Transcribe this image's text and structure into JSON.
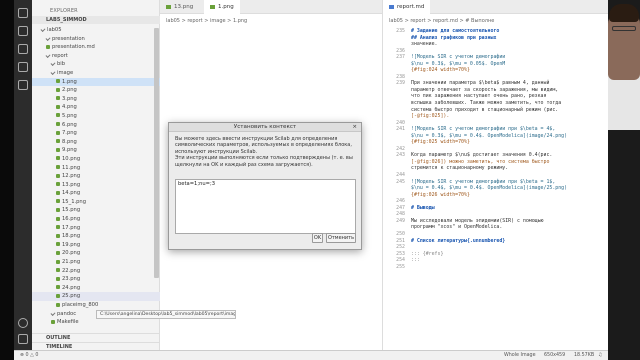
{
  "explorer": {
    "title": "EXPLORER",
    "project": "LAB5_SIMMOD",
    "items": [
      {
        "label": "lab05",
        "kind": "folder",
        "indent": 1
      },
      {
        "label": "presentation",
        "kind": "folder",
        "indent": 2
      },
      {
        "label": "presentation.md",
        "kind": "file",
        "indent": 2
      },
      {
        "label": "report",
        "kind": "folder",
        "indent": 2
      },
      {
        "label": "bib",
        "kind": "folder",
        "indent": 3
      },
      {
        "label": "image",
        "kind": "folder",
        "indent": 3
      },
      {
        "label": "1.png",
        "kind": "file",
        "indent": 4,
        "selected": true
      },
      {
        "label": "2.png",
        "kind": "file",
        "indent": 4
      },
      {
        "label": "3.png",
        "kind": "file",
        "indent": 4
      },
      {
        "label": "4.png",
        "kind": "file",
        "indent": 4
      },
      {
        "label": "5.png",
        "kind": "file",
        "indent": 4
      },
      {
        "label": "6.png",
        "kind": "file",
        "indent": 4
      },
      {
        "label": "7.png",
        "kind": "file",
        "indent": 4
      },
      {
        "label": "8.png",
        "kind": "file",
        "indent": 4
      },
      {
        "label": "9.png",
        "kind": "file",
        "indent": 4
      },
      {
        "label": "10.png",
        "kind": "file",
        "indent": 4
      },
      {
        "label": "11.png",
        "kind": "file",
        "indent": 4
      },
      {
        "label": "12.png",
        "kind": "file",
        "indent": 4
      },
      {
        "label": "13.png",
        "kind": "file",
        "indent": 4
      },
      {
        "label": "14.png",
        "kind": "file",
        "indent": 4
      },
      {
        "label": "15_1.png",
        "kind": "file",
        "indent": 4
      },
      {
        "label": "15.png",
        "kind": "file",
        "indent": 4
      },
      {
        "label": "16.png",
        "kind": "file",
        "indent": 4
      },
      {
        "label": "17.png",
        "kind": "file",
        "indent": 4
      },
      {
        "label": "18.png",
        "kind": "file",
        "indent": 4
      },
      {
        "label": "19.png",
        "kind": "file",
        "indent": 4
      },
      {
        "label": "20.png",
        "kind": "file",
        "indent": 4
      },
      {
        "label": "21.png",
        "kind": "file",
        "indent": 4
      },
      {
        "label": "22.png",
        "kind": "file",
        "indent": 4
      },
      {
        "label": "23.png",
        "kind": "file",
        "indent": 4
      },
      {
        "label": "24.png",
        "kind": "file",
        "indent": 4
      },
      {
        "label": "25.png",
        "kind": "file",
        "indent": 4,
        "hover": true
      },
      {
        "label": "placeimg_800",
        "kind": "file",
        "indent": 4
      },
      {
        "label": "pandoc",
        "kind": "folder",
        "indent": 3
      },
      {
        "label": "Makefile",
        "kind": "file",
        "indent": 3
      }
    ],
    "tooltip": "C:\\Users\\angelina\\Desktop\\lab5_simmod\\lab05\\report\\image\\25.png",
    "outline": "OUTLINE",
    "timeline": "TIMELINE"
  },
  "image_pane": {
    "tabs": [
      "13.png",
      "1.png"
    ],
    "breadcrumb": "lab05 > report > image > 1.png"
  },
  "md_pane": {
    "tab": "report.md",
    "breadcrumb": "lab05 > report > report.md > # Выполне",
    "lines": [
      {
        "n": "235",
        "t": "# Задание для самостоятельного",
        "c": "h"
      },
      {
        "n": "",
        "t": "## Анализ графиков при разных",
        "c": "h"
      },
      {
        "n": "",
        "t": "значение.",
        "c": ""
      },
      {
        "n": "236",
        "t": "",
        "c": ""
      },
      {
        "n": "237",
        "t": "![Модель SIR с учетом демографии",
        "c": "link"
      },
      {
        "n": "",
        "t": "$\\nu = 0.3$, $\\mu = 0.05$. OpenM",
        "c": "link"
      },
      {
        "n": "",
        "t": "{#fig:024 width=70%}",
        "c": "ref"
      },
      {
        "n": "238",
        "t": "",
        "c": ""
      },
      {
        "n": "239",
        "t": "При значении параметра $\\beta$ равным 4, данный",
        "c": ""
      },
      {
        "n": "",
        "t": "параметр отвечает за скорость заражения, мы видим,",
        "c": ""
      },
      {
        "n": "",
        "t": "что пик заражения наступает очень рано, резкая",
        "c": ""
      },
      {
        "n": "",
        "t": "вспышка заболевших. Также можно заметить, что тогда",
        "c": ""
      },
      {
        "n": "",
        "t": "система быстро приходит в стационарный режим (рис.",
        "c": ""
      },
      {
        "n": "",
        "t": "[-@fig:025]).",
        "c": "ref"
      },
      {
        "n": "240",
        "t": "",
        "c": ""
      },
      {
        "n": "241",
        "t": "![Модель SIR с учетом демографии при $\\beta = 4$,",
        "c": "link"
      },
      {
        "n": "",
        "t": "$\\nu = 0.3$, $\\mu = 0.4$. OpenModelica](image/24.png)",
        "c": "link"
      },
      {
        "n": "",
        "t": "{#fig:025 width=70%}",
        "c": "ref"
      },
      {
        "n": "242",
        "t": "",
        "c": ""
      },
      {
        "n": "243",
        "t": "Когда параметр $\\nu$ достигает значения 0.4(рис.",
        "c": ""
      },
      {
        "n": "",
        "t": "[-@fig:026]) можно заметить, что система быстро",
        "c": "ref"
      },
      {
        "n": "",
        "t": "стремится к стационарному режиму.",
        "c": ""
      },
      {
        "n": "244",
        "t": "",
        "c": ""
      },
      {
        "n": "245",
        "t": "![Модель SIR с учетом демографии при $\\beta = 1$,",
        "c": "link"
      },
      {
        "n": "",
        "t": "$\\nu = 0.4$, $\\mu = 0.4$. OpenModelica](image/25.png)",
        "c": "link"
      },
      {
        "n": "",
        "t": "{#fig:026 width=70%}",
        "c": "ref"
      },
      {
        "n": "246",
        "t": "",
        "c": ""
      },
      {
        "n": "247",
        "t": "# Выводы",
        "c": "h"
      },
      {
        "n": "248",
        "t": "",
        "c": ""
      },
      {
        "n": "249",
        "t": "Мы исследовали модель эпидемии(SIR) с помощью",
        "c": ""
      },
      {
        "n": "",
        "t": "программ \"xcos\" и OpenModelica.",
        "c": ""
      },
      {
        "n": "250",
        "t": "",
        "c": ""
      },
      {
        "n": "251",
        "t": "# Список литературы{.unnumbered}",
        "c": "h"
      },
      {
        "n": "252",
        "t": "",
        "c": ""
      },
      {
        "n": "253",
        "t": "::: {#refs}",
        "c": "blk"
      },
      {
        "n": "254",
        "t": ":::",
        "c": "blk"
      },
      {
        "n": "255",
        "t": "",
        "c": ""
      }
    ]
  },
  "dialog": {
    "title": "Установить контекст",
    "close_glyph": "×",
    "message_lines": [
      "Вы можете здесь ввести инструкции Scilab для определения",
      "символических параметров, используемых в определениях блока,",
      "используют инструкции Scilab.",
      "Эти инструкции выполняются если только подтверждены (т. е. вы",
      "щелкнули на OK и каждый раз схема загружается)."
    ],
    "input_value": "beta=1;nu=;3",
    "ok_label": "OK",
    "cancel_label": "Отменить"
  },
  "statusbar": {
    "left_errors": "⊗ 0 △ 0",
    "whole_image": "Whole Image",
    "dimensions": "650x459",
    "size": "18.57KB",
    "bell": "♫"
  },
  "colors": {
    "selection": "#cfe2f7",
    "dialog_bg": "#ececec",
    "heading": "#1a56b0"
  }
}
